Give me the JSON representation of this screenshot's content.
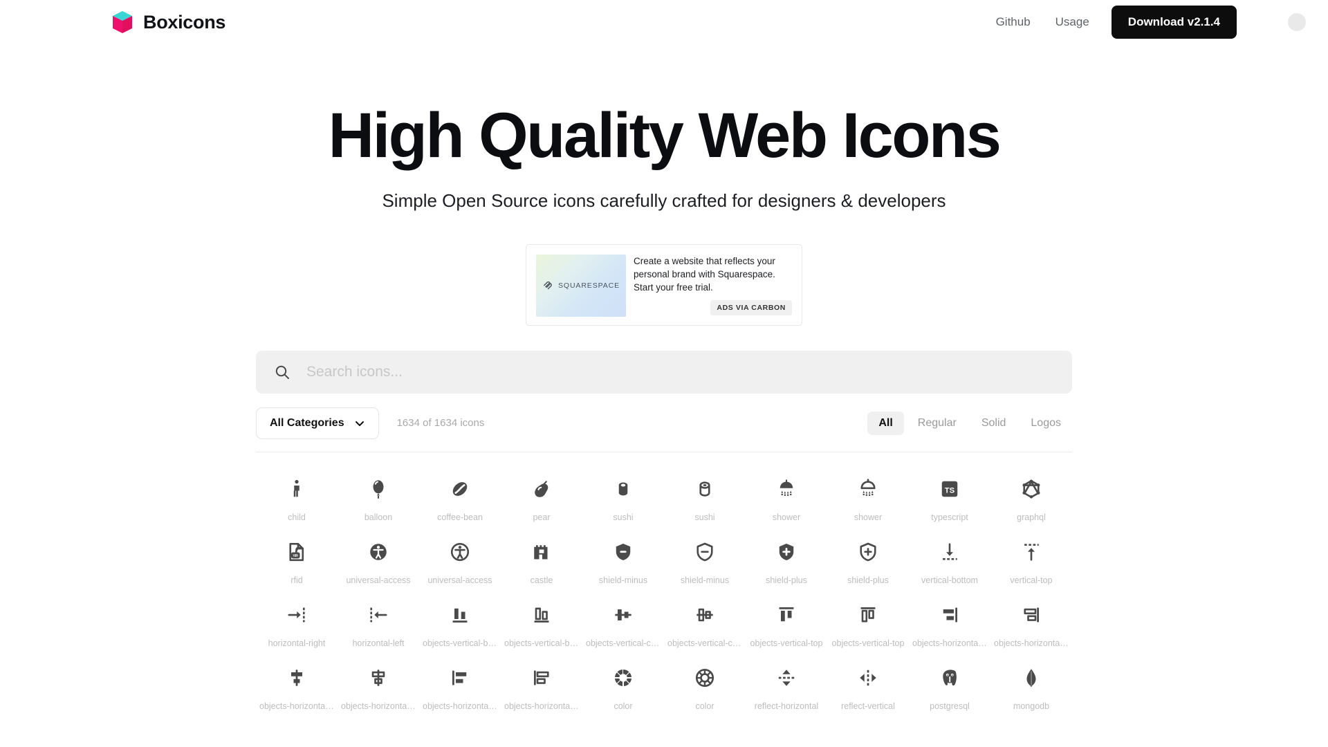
{
  "header": {
    "brand_name": "Boxicons",
    "logo_icon": "boxicons-cube-logo",
    "logo_colors": {
      "top": "#3ad5d5",
      "front": "#ef0f6d",
      "side": "#c90d5c"
    },
    "nav": [
      {
        "label": "Github",
        "name": "nav-link-github"
      },
      {
        "label": "Usage",
        "name": "nav-link-usage"
      }
    ],
    "download_label": "Download v2.1.4",
    "theme_toggle_icon": "dark-mode-moon-icon"
  },
  "hero": {
    "title": "High Quality Web Icons",
    "subtitle": "Simple Open Source icons carefully crafted for designers & developers"
  },
  "ad": {
    "image_alt": "squarespace-gradient-banner",
    "brand_mark_icon": "squarespace-logo-icon",
    "brand_word": "SQUARESPACE",
    "text": "Create a website that reflects your personal brand with Squarespace. Start your free trial.",
    "powered_by": "ADS VIA CARBON"
  },
  "search": {
    "icon": "search-icon",
    "placeholder": "Search icons...",
    "value": ""
  },
  "filters": {
    "category_label": "All Categories",
    "category_chevron": "chevron-down-icon",
    "count_text": "1634 of 1634 icons",
    "tabs": [
      {
        "label": "All",
        "active": true
      },
      {
        "label": "Regular",
        "active": false
      },
      {
        "label": "Solid",
        "active": false
      },
      {
        "label": "Logos",
        "active": false
      }
    ]
  },
  "icons": [
    {
      "label": "child",
      "glyph": "child"
    },
    {
      "label": "balloon",
      "glyph": "balloon"
    },
    {
      "label": "coffee-bean",
      "glyph": "coffee-bean"
    },
    {
      "label": "pear",
      "glyph": "pear"
    },
    {
      "label": "sushi",
      "glyph": "sushi-solid"
    },
    {
      "label": "sushi",
      "glyph": "sushi-regular"
    },
    {
      "label": "shower",
      "glyph": "shower-solid"
    },
    {
      "label": "shower",
      "glyph": "shower-regular"
    },
    {
      "label": "typescript",
      "glyph": "typescript"
    },
    {
      "label": "graphql",
      "glyph": "graphql"
    },
    {
      "label": "rfid",
      "glyph": "rfid"
    },
    {
      "label": "universal-access",
      "glyph": "universal-access-solid"
    },
    {
      "label": "universal-access",
      "glyph": "universal-access-regular"
    },
    {
      "label": "castle",
      "glyph": "castle"
    },
    {
      "label": "shield-minus",
      "glyph": "shield-minus-solid"
    },
    {
      "label": "shield-minus",
      "glyph": "shield-minus-regular"
    },
    {
      "label": "shield-plus",
      "glyph": "shield-plus-solid"
    },
    {
      "label": "shield-plus",
      "glyph": "shield-plus-regular"
    },
    {
      "label": "vertical-bottom",
      "glyph": "vertical-bottom"
    },
    {
      "label": "vertical-top",
      "glyph": "vertical-top"
    },
    {
      "label": "horizontal-right",
      "glyph": "horizontal-right"
    },
    {
      "label": "horizontal-left",
      "glyph": "horizontal-left"
    },
    {
      "label": "objects-vertical-bottom",
      "glyph": "obj-v-bottom-solid"
    },
    {
      "label": "objects-vertical-bottom",
      "glyph": "obj-v-bottom-regular"
    },
    {
      "label": "objects-vertical-center",
      "glyph": "obj-v-center-solid"
    },
    {
      "label": "objects-vertical-center",
      "glyph": "obj-v-center-regular"
    },
    {
      "label": "objects-vertical-top",
      "glyph": "obj-v-top-solid"
    },
    {
      "label": "objects-vertical-top",
      "glyph": "obj-v-top-regular"
    },
    {
      "label": "objects-horizontal-right",
      "glyph": "obj-h-right-solid"
    },
    {
      "label": "objects-horizontal-right",
      "glyph": "obj-h-right-regular"
    },
    {
      "label": "objects-horizontal-center",
      "glyph": "obj-h-center-solid"
    },
    {
      "label": "objects-horizontal-center",
      "glyph": "obj-h-center-regular"
    },
    {
      "label": "objects-horizontal-left",
      "glyph": "obj-h-left-solid"
    },
    {
      "label": "objects-horizontal-left",
      "glyph": "obj-h-left-regular"
    },
    {
      "label": "color",
      "glyph": "color-solid"
    },
    {
      "label": "color",
      "glyph": "color-regular"
    },
    {
      "label": "reflect-horizontal",
      "glyph": "reflect-horizontal"
    },
    {
      "label": "reflect-vertical",
      "glyph": "reflect-vertical"
    },
    {
      "label": "postgresql",
      "glyph": "postgresql"
    },
    {
      "label": "mongodb",
      "glyph": "mongodb"
    }
  ]
}
